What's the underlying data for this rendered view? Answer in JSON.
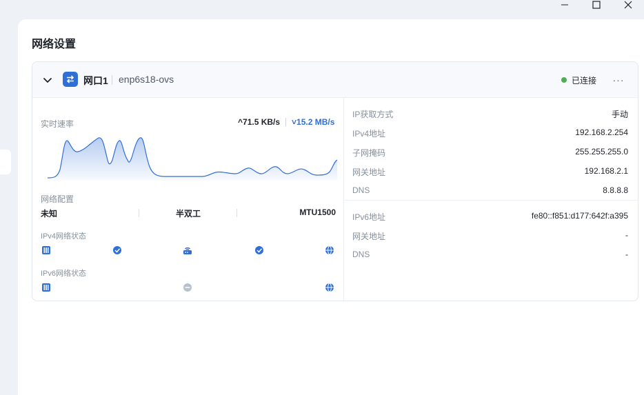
{
  "window": {
    "controls": [
      "minimize",
      "maximize",
      "close"
    ]
  },
  "page": {
    "title": "网络设置"
  },
  "port": {
    "name": "网口1",
    "device": "enp6s18-ovs",
    "status": "已连接",
    "status_color": "#4caf50",
    "more": "···"
  },
  "realtime": {
    "label": "实时速率",
    "up": "71.5 KB/s",
    "down": "15.2 MB/s",
    "up_arrow": "^",
    "down_arrow": "˅"
  },
  "config": {
    "label": "网络配置",
    "speed": "未知",
    "duplex": "半双工",
    "mtu": "MTU1500"
  },
  "ipv4_state": {
    "label": "IPv4网络状态"
  },
  "ipv6_state": {
    "label": "IPv6网络状态"
  },
  "ipv4": {
    "mode_label": "IP获取方式",
    "mode": "手动",
    "addr_label": "IPv4地址",
    "addr": "192.168.2.254",
    "mask_label": "子网掩码",
    "mask": "255.255.255.0",
    "gw_label": "网关地址",
    "gw": "192.168.2.1",
    "dns_label": "DNS",
    "dns": "8.8.8.8"
  },
  "ipv6": {
    "addr_label": "IPv6地址",
    "addr": "fe80::f851:d177:642f:a395",
    "gw_label": "网关地址",
    "gw": "-",
    "dns_label": "DNS",
    "dns": "-"
  },
  "colors": {
    "accent": "#2f6fd6",
    "connected": "#4caf50",
    "inactive": "#b7c0cc"
  }
}
